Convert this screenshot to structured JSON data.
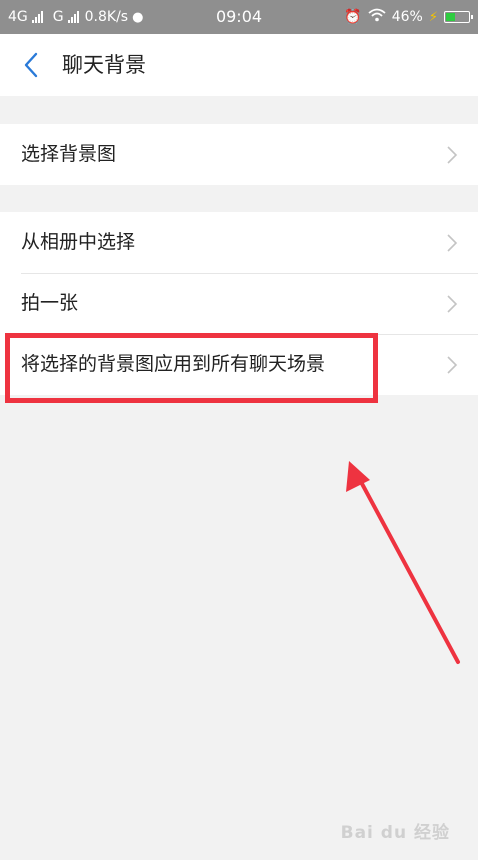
{
  "status_bar": {
    "network1": "4G",
    "network2": "G",
    "speed": "0.8K/s",
    "time": "09:04",
    "battery": "46%",
    "battery_level": 0.46
  },
  "header": {
    "title": "聊天背景",
    "back_icon": "chevron-left-icon"
  },
  "groups": [
    {
      "items": [
        {
          "label": "选择背景图"
        }
      ]
    },
    {
      "items": [
        {
          "label": "从相册中选择"
        },
        {
          "label": "拍一张"
        },
        {
          "label": "将选择的背景图应用到所有聊天场景"
        }
      ]
    }
  ],
  "annotation": {
    "highlight_color": "#ee3340"
  },
  "watermark": "Bai du 经验"
}
